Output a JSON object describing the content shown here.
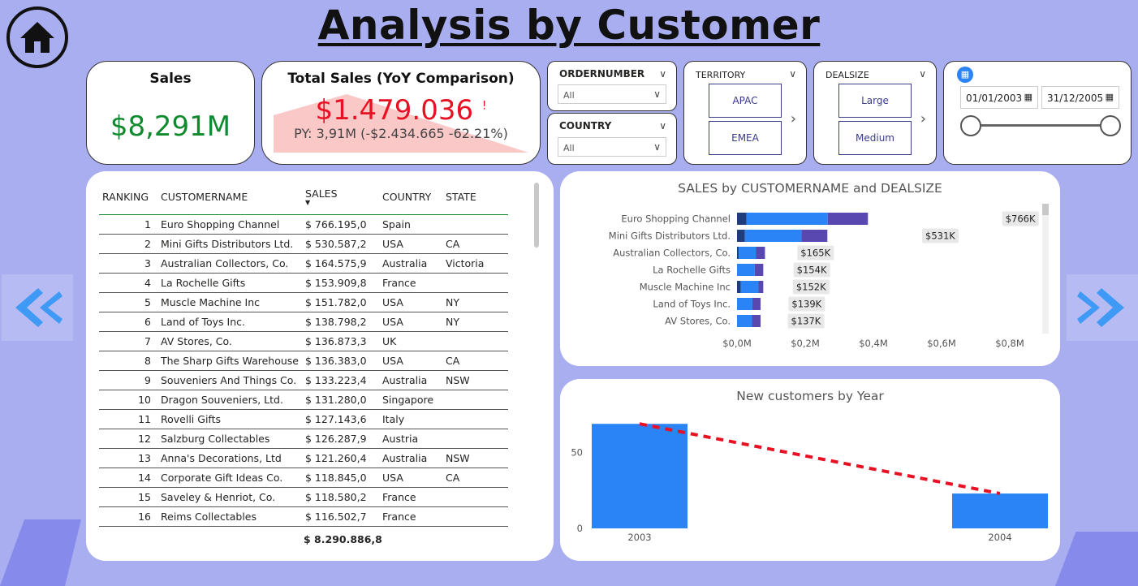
{
  "page_title": "Analysis by Customer",
  "kpi_sales": {
    "title": "Sales",
    "value": "$8,291M"
  },
  "kpi_yoy": {
    "title": "Total Sales (YoY Comparison)",
    "value": "$1.479.036",
    "mark": "!",
    "py": "PY: 3,91M (-$2.434.665 -62.21%)"
  },
  "slicers": {
    "ordernumber": {
      "label": "ORDERNUMBER",
      "value": "All"
    },
    "country": {
      "label": "COUNTRY",
      "value": "All"
    },
    "territory": {
      "label": "TERRITORY",
      "options": [
        "APAC",
        "EMEA"
      ]
    },
    "dealsize": {
      "label": "DEALSIZE",
      "options": [
        "Large",
        "Medium"
      ]
    },
    "date": {
      "start": "01/01/2003",
      "end": "31/12/2005"
    }
  },
  "table": {
    "columns": [
      "RANKING",
      "CUSTOMERNAME",
      "SALES",
      "COUNTRY",
      "STATE"
    ],
    "rows": [
      [
        "1",
        "Euro Shopping Channel",
        "$ 766.195,0",
        "Spain",
        ""
      ],
      [
        "2",
        "Mini Gifts Distributors Ltd.",
        "$ 530.587,2",
        "USA",
        "CA"
      ],
      [
        "3",
        "Australian Collectors, Co.",
        "$ 164.575,9",
        "Australia",
        "Victoria"
      ],
      [
        "4",
        "La Rochelle Gifts",
        "$ 153.909,8",
        "France",
        ""
      ],
      [
        "5",
        "Muscle Machine Inc",
        "$ 151.782,0",
        "USA",
        "NY"
      ],
      [
        "6",
        "Land of Toys Inc.",
        "$ 138.798,2",
        "USA",
        "NY"
      ],
      [
        "7",
        "AV Stores, Co.",
        "$ 136.873,3",
        "UK",
        ""
      ],
      [
        "8",
        "The Sharp Gifts Warehouse",
        "$ 136.383,0",
        "USA",
        "CA"
      ],
      [
        "9",
        "Souveniers And Things Co.",
        "$ 133.223,4",
        "Australia",
        "NSW"
      ],
      [
        "10",
        "Dragon Souveniers, Ltd.",
        "$ 131.280,0",
        "Singapore",
        ""
      ],
      [
        "11",
        "Rovelli Gifts",
        "$ 127.143,6",
        "Italy",
        ""
      ],
      [
        "12",
        "Salzburg Collectables",
        "$ 126.287,9",
        "Austria",
        ""
      ],
      [
        "13",
        "Anna's Decorations, Ltd",
        "$ 121.260,4",
        "Australia",
        "NSW"
      ],
      [
        "14",
        "Corporate Gift Ideas Co.",
        "$ 118.845,0",
        "USA",
        "CA"
      ],
      [
        "15",
        "Saveley & Henriot, Co.",
        "$ 118.580,2",
        "France",
        ""
      ],
      [
        "16",
        "Reims Collectables",
        "$ 116.502,7",
        "France",
        ""
      ]
    ],
    "total": "$ 8.290.886,8"
  },
  "chart_data": [
    {
      "type": "bar",
      "orientation": "horizontal",
      "stacked": true,
      "title": "SALES by CUSTOMERNAME and DEALSIZE",
      "categories": [
        "Euro Shopping Channel",
        "Mini Gifts Distributors Ltd.",
        "Australian Collectors, Co.",
        "La Rochelle Gifts",
        "Muscle Machine Inc",
        "Land of Toys Inc.",
        "AV Stores, Co."
      ],
      "series": [
        {
          "values": [
            0.028,
            0.023,
            0.005,
            0.0,
            0.011,
            0.0,
            0.0
          ],
          "color": "#1f3d7a"
        },
        {
          "values": [
            0.238,
            0.166,
            0.05,
            0.052,
            0.052,
            0.045,
            0.044
          ],
          "color": "#2b84f5"
        },
        {
          "values": [
            0.118,
            0.076,
            0.027,
            0.025,
            0.014,
            0.024,
            0.025
          ],
          "color": "#5848b0"
        }
      ],
      "data_labels": [
        "$766K",
        "$531K",
        "$165K",
        "$154K",
        "$152K",
        "$139K",
        "$137K"
      ],
      "totals": [
        0.766,
        0.531,
        0.165,
        0.154,
        0.152,
        0.139,
        0.137
      ],
      "xlim": [
        0,
        0.9
      ],
      "xticks": [
        "$0,0M",
        "$0,2M",
        "$0,4M",
        "$0,6M",
        "$0,8M"
      ],
      "xtick_values": [
        0,
        0.2,
        0.4,
        0.6,
        0.8
      ]
    },
    {
      "type": "bar",
      "title": "New customers by Year",
      "categories": [
        "2003",
        "2004"
      ],
      "values": [
        69,
        23
      ],
      "ylim": [
        0,
        75
      ],
      "yticks": [
        "0",
        "50"
      ],
      "ytick_values": [
        0,
        50
      ],
      "trend_line": true,
      "bar_color": "#2b84f5",
      "trend_color": "#e81123"
    }
  ]
}
